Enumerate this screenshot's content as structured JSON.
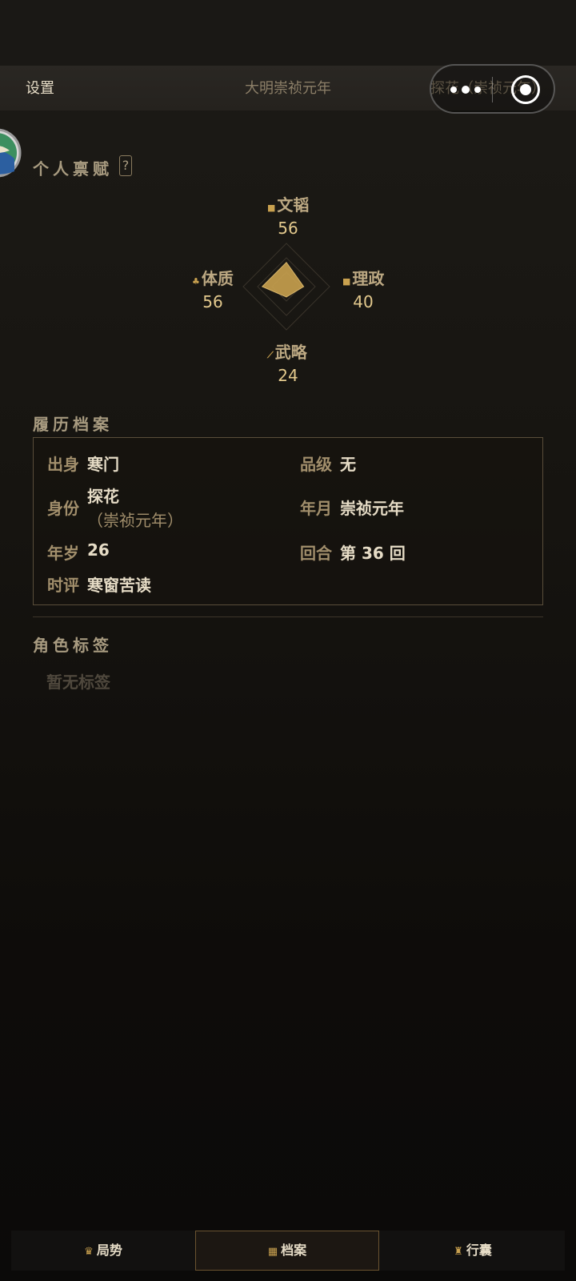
{
  "topbar": {
    "settings": "设置",
    "era": "大明崇祯元年",
    "rank": "探花（崇祯元年）"
  },
  "profile": {
    "section_title": "个人禀赋",
    "help": "?",
    "stats": {
      "top": {
        "label": "文韬",
        "value": "56",
        "icon": "book-icon"
      },
      "left": {
        "label": "体质",
        "value": "56",
        "icon": "person-icon"
      },
      "right": {
        "label": "理政",
        "value": "40",
        "icon": "scroll-icon"
      },
      "bottom": {
        "label": "武略",
        "value": "24",
        "icon": "sword-icon"
      }
    },
    "radar_max": 100
  },
  "record": {
    "section_title": "履历档案",
    "rows": {
      "origin": {
        "label": "出身",
        "value": "寒门"
      },
      "grade": {
        "label": "品级",
        "value": "无"
      },
      "identity": {
        "label": "身份",
        "value": "探花",
        "sub": "（崇祯元年）"
      },
      "date": {
        "label": "年月",
        "value": "崇祯元年"
      },
      "age": {
        "label": "年岁",
        "value": "26"
      },
      "round": {
        "label": "回合",
        "value": "第 36 回"
      },
      "review": {
        "label": "时评",
        "value": "寒窗苦读"
      }
    }
  },
  "tags": {
    "section_title": "角色标签",
    "empty": "暂无标签"
  },
  "tabs": [
    {
      "label": "局势",
      "icon": "crown-icon"
    },
    {
      "label": "档案",
      "icon": "book-icon"
    },
    {
      "label": "行囊",
      "icon": "bag-icon"
    }
  ],
  "colors": {
    "accent": "#c9a14f",
    "radar_fill": "#c9a14f"
  }
}
